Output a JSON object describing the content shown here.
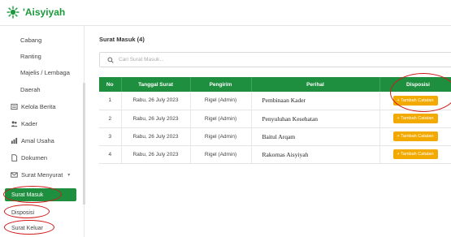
{
  "brand": {
    "name": "'Aisyiyah",
    "color": "#1a9a3a"
  },
  "sidebar": {
    "items": [
      {
        "label": "Cabang",
        "icon": "",
        "level": "sub"
      },
      {
        "label": "Ranting",
        "icon": "",
        "level": "sub"
      },
      {
        "label": "Majelis / Lembaga",
        "icon": "",
        "level": "sub"
      },
      {
        "label": "Daerah",
        "icon": "",
        "level": "sub"
      },
      {
        "label": "Kelola Berita",
        "icon": "news-icon",
        "level": "main"
      },
      {
        "label": "Kader",
        "icon": "users-icon",
        "level": "main"
      },
      {
        "label": "Amal Usaha",
        "icon": "chart-icon",
        "level": "main"
      },
      {
        "label": "Dokumen",
        "icon": "document-icon",
        "level": "main"
      },
      {
        "label": "Surat Menyurat",
        "icon": "mail-icon",
        "level": "main",
        "caret": "▾"
      }
    ],
    "active": "Surat Masuk",
    "sub_after": [
      "Disposisi",
      "Surat Keluar"
    ]
  },
  "main": {
    "title": "Surat Masuk (4)",
    "search_placeholder": "Cari Surat Masuk...",
    "table": {
      "headers": [
        "No",
        "Tanggal Surat",
        "Pengirim",
        "Perihal",
        "Disposisi"
      ],
      "rows": [
        {
          "no": "1",
          "tanggal": "Rabu, 26 July 2023",
          "pengirim": "Rigel (Admin)",
          "perihal": "Pembinaan Kader",
          "aksi": "+ Tambah Catatan"
        },
        {
          "no": "2",
          "tanggal": "Rabu, 26 July 2023",
          "pengirim": "Rigel (Admin)",
          "perihal": "Penyuluhan Kesehatan",
          "aksi": "+ Tambah Catatan"
        },
        {
          "no": "3",
          "tanggal": "Rabu, 26 July 2023",
          "pengirim": "Rigel (Admin)",
          "perihal": "Baitul Arqam",
          "aksi": "+ Tambah Catatan"
        },
        {
          "no": "4",
          "tanggal": "Rabu, 26 July 2023",
          "pengirim": "Rigel (Admin)",
          "perihal": "Rakornas Aisyiyah",
          "aksi": "+ Tambah Catatan"
        }
      ]
    }
  },
  "colors": {
    "primary": "#1e8f3e",
    "button": "#f2a900",
    "annotation": "#d0191a"
  }
}
